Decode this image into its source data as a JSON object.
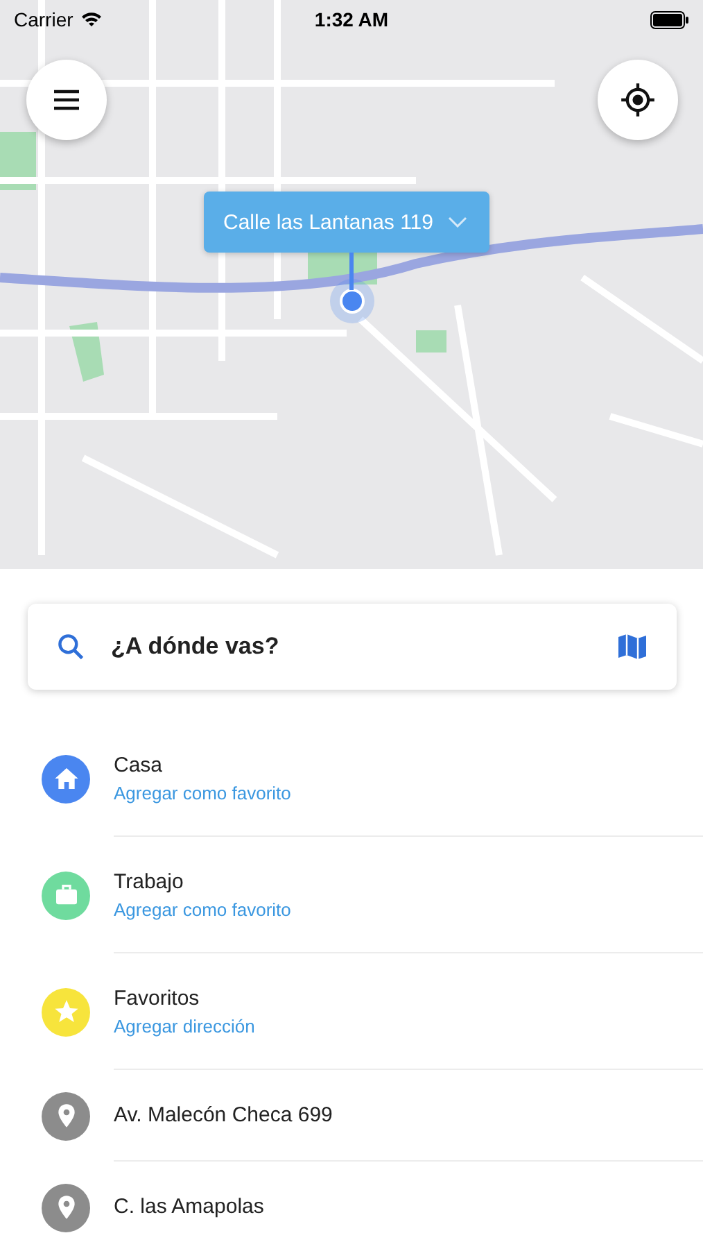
{
  "status_bar": {
    "carrier": "Carrier",
    "time": "1:32 AM"
  },
  "map": {
    "address_bubble": "Calle las Lantanas 119"
  },
  "search": {
    "placeholder": "¿A dónde vas?"
  },
  "places": [
    {
      "kind": "home",
      "color": "#4a86f0",
      "title": "Casa",
      "action": "Agregar como favorito"
    },
    {
      "kind": "work",
      "color": "#6fdb9e",
      "title": "Trabajo",
      "action": "Agregar como favorito"
    },
    {
      "kind": "favorites",
      "color": "#f7e43c",
      "title": "Favoritos",
      "action": "Agregar dirección"
    },
    {
      "kind": "recent",
      "color": "#8c8c8c",
      "title": "Av. Malecón Checa 699"
    },
    {
      "kind": "recent",
      "color": "#8c8c8c",
      "title": "C. las Amapolas"
    }
  ]
}
